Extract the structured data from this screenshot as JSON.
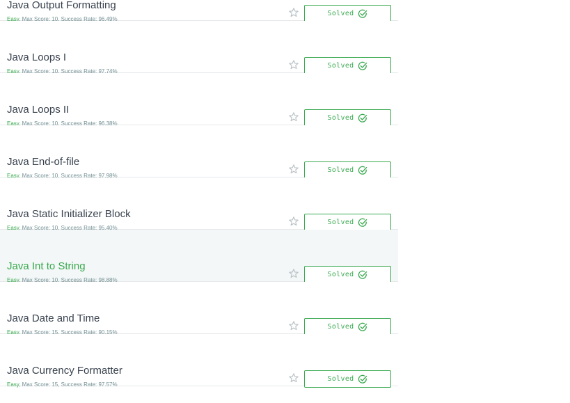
{
  "challenges": [
    {
      "title": "Java Output Formatting",
      "difficulty": "Easy",
      "meta_rest": ", Max Score: 10, Success Rate: 96.49%",
      "status": "Solved"
    },
    {
      "title": "Java Loops I",
      "difficulty": "Easy",
      "meta_rest": ", Max Score: 10, Success Rate: 97.74%",
      "status": "Solved"
    },
    {
      "title": "Java Loops II",
      "difficulty": "Easy",
      "meta_rest": ", Max Score: 10, Success Rate: 96.38%",
      "status": "Solved"
    },
    {
      "title": "Java End-of-file",
      "difficulty": "Easy",
      "meta_rest": ", Max Score: 10, Success Rate: 97.98%",
      "status": "Solved"
    },
    {
      "title": "Java Static Initializer Block",
      "difficulty": "Easy",
      "meta_rest": ", Max Score: 10, Success Rate: 95.40%",
      "status": "Solved"
    },
    {
      "title": "Java Int to String",
      "difficulty": "Easy",
      "meta_rest": ", Max Score: 10, Success Rate: 98.88%",
      "status": "Solved",
      "hovered": true
    },
    {
      "title": "Java Date and Time",
      "difficulty": "Easy",
      "meta_rest": ", Max Score: 15, Success Rate: 90.15%",
      "status": "Solved"
    },
    {
      "title": "Java Currency Formatter",
      "difficulty": "Easy",
      "meta_rest": ", Max Score: 15, Success Rate: 97.57%",
      "status": "Solved"
    }
  ],
  "icons": {
    "star": "star-outline-icon",
    "check": "check-circle-icon"
  },
  "colors": {
    "accent": "#39a94f",
    "title": "#39424e",
    "meta": "#738f93",
    "hover_bg": "#f3f7f7",
    "divider": "#e6e8ea",
    "star": "#b6bfc4"
  }
}
